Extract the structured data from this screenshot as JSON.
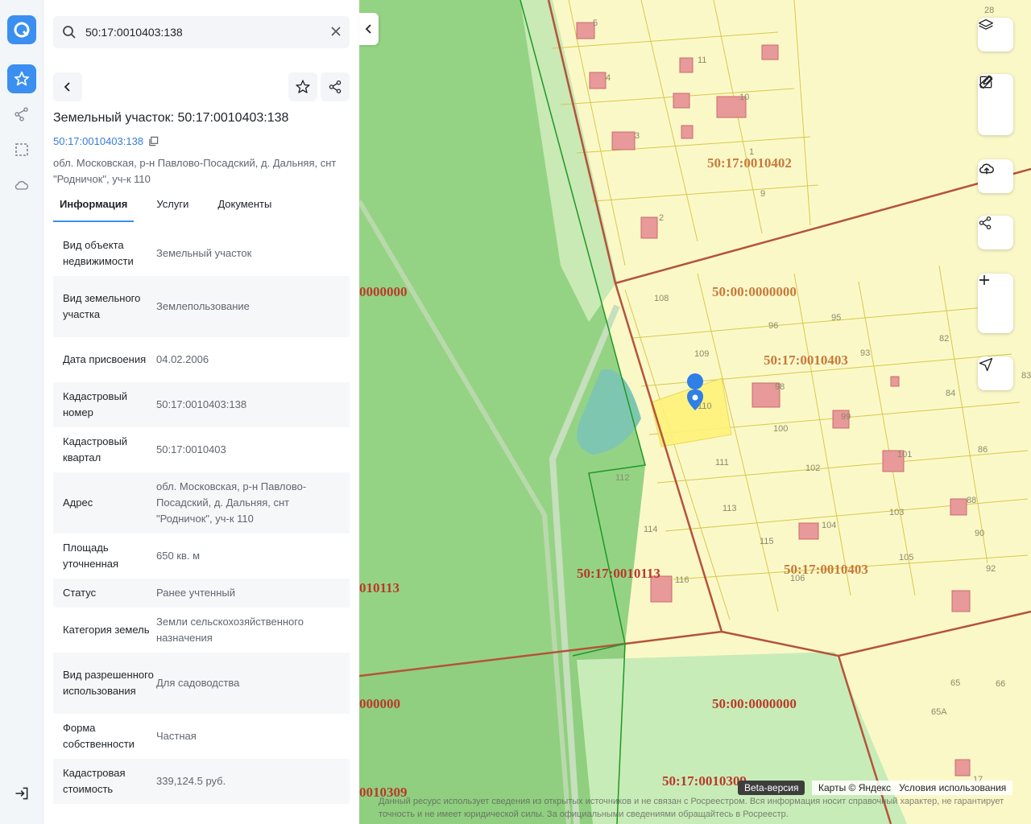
{
  "search": {
    "value": "50:17:0010403:138"
  },
  "object": {
    "title": "Земельный участок: 50:17:0010403:138",
    "cadastral_link": "50:17:0010403:138",
    "address": "обл. Московская, р-н Павлово-Посадский, д. Дальняя, снт \"Родничок\", уч-к 110"
  },
  "tabs": [
    {
      "label": "Информация",
      "active": true
    },
    {
      "label": "Услуги",
      "active": false
    },
    {
      "label": "Документы",
      "active": false
    }
  ],
  "info_rows": [
    {
      "key": "Вид объекта недвижимости",
      "value": "Земельный участок"
    },
    {
      "key": "Вид земельного участка",
      "value": "Землепользование"
    },
    {
      "key": "Дата присвоения",
      "value": "04.02.2006"
    },
    {
      "key": "Кадастровый номер",
      "value": "50:17:0010403:138"
    },
    {
      "key": "Кадастровый квартал",
      "value": "50:17:0010403"
    },
    {
      "key": "Адрес",
      "value": "обл. Московская, р-н Павлово-Посадский, д. Дальняя, снт \"Родничок\", уч-к 110"
    },
    {
      "key": "Площадь уточненная",
      "value": "650 кв. м"
    },
    {
      "key": "Статус",
      "value": "Ранее учтенный"
    },
    {
      "key": "Категория земель",
      "value": "Земли сельскохозяйственного назначения"
    },
    {
      "key": "Вид разрешенного использования",
      "value": "Для садоводства"
    },
    {
      "key": "Форма собственности",
      "value": "Частная"
    },
    {
      "key": "Кадастровая стоимость",
      "value": "339,124.5 руб."
    }
  ],
  "map": {
    "quarter_labels": [
      "50:17:0010402",
      "50:00:0000000",
      "50:17:0010403",
      "50:17:0010403",
      "50:17:0010113",
      "50:00:0000000",
      "50:17:0010309",
      "0000000",
      "010113",
      "000000",
      "0010309"
    ],
    "plot_numbers": [
      "5",
      "11",
      "4",
      "10",
      "3",
      "1",
      "9",
      "2",
      "108",
      "96",
      "95",
      "82",
      "109",
      "93",
      "83",
      "84",
      "110",
      "98",
      "100",
      "99",
      "86",
      "112",
      "111",
      "102",
      "101",
      "113",
      "103",
      "88",
      "114",
      "115",
      "104",
      "90",
      "105",
      "92",
      "106",
      "116",
      "65",
      "66",
      "65А",
      "17",
      "28"
    ],
    "beta_label": "Beta-версия",
    "attribution": "Карты © Яндекс",
    "terms_link": "Условия использования",
    "disclaimer": "Данный ресурс использует сведения из открытых источников и не связан с Росреестром. Вся информация носит справочный характер, не гарантирует точность и не имеет юридической силы. За официальными сведениями обращайтесь в Росреестр."
  },
  "colors": {
    "accent": "#3a8ff0",
    "forest": "#95d384",
    "plots": "#fbf4a6",
    "boundary": "#b5533a"
  }
}
